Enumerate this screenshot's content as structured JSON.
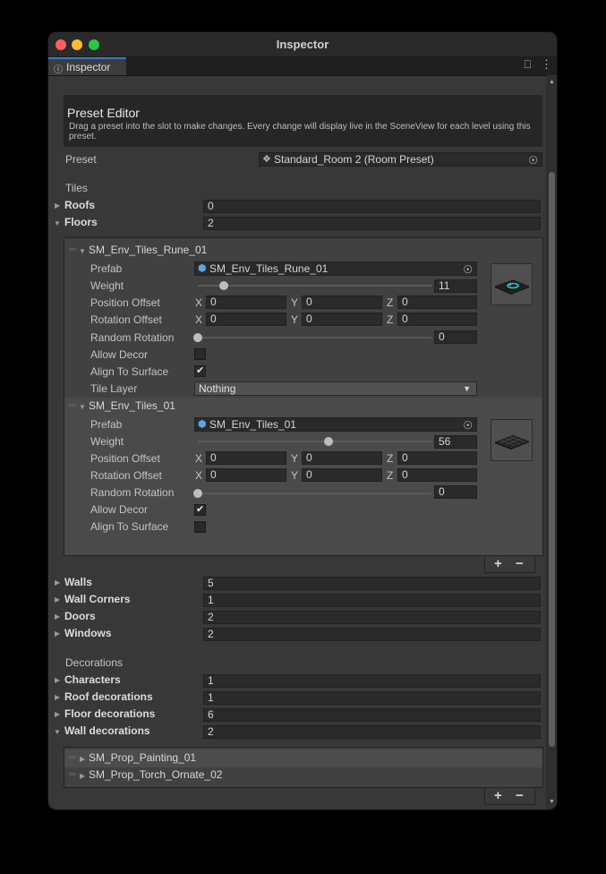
{
  "window": {
    "title": "Inspector"
  },
  "tab": {
    "label": "Inspector"
  },
  "header": {
    "title": "Preset Editor",
    "description": "Drag a preset into the slot to make changes. Every change will display live in the SceneView for each level using this preset."
  },
  "preset": {
    "label": "Preset",
    "value": "Standard_Room 2 (Room Preset)"
  },
  "tiles": {
    "section": "Tiles",
    "roofs": {
      "label": "Roofs",
      "value": "0"
    },
    "floors": {
      "label": "Floors",
      "value": "2"
    }
  },
  "floor_items": [
    {
      "name": "SM_Env_Tiles_Rune_01",
      "prefab_label": "Prefab",
      "prefab": "SM_Env_Tiles_Rune_01",
      "weight_label": "Weight",
      "weight": "11",
      "weight_fraction": 0.11,
      "position_label": "Position Offset",
      "pos_x": "0",
      "pos_y": "0",
      "pos_z": "0",
      "rotation_label": "Rotation Offset",
      "rot_x": "0",
      "rot_y": "0",
      "rot_z": "0",
      "random_rotation_label": "Random Rotation",
      "random_rotation": "0",
      "random_rotation_fraction": 0,
      "allow_decor_label": "Allow Decor",
      "allow_decor": false,
      "align_label": "Align To Surface",
      "align": true,
      "tile_layer_label": "Tile Layer",
      "tile_layer": "Nothing"
    },
    {
      "name": "SM_Env_Tiles_01",
      "prefab_label": "Prefab",
      "prefab": "SM_Env_Tiles_01",
      "weight_label": "Weight",
      "weight": "56",
      "weight_fraction": 0.56,
      "position_label": "Position Offset",
      "pos_x": "0",
      "pos_y": "0",
      "pos_z": "0",
      "rotation_label": "Rotation Offset",
      "rot_x": "0",
      "rot_y": "0",
      "rot_z": "0",
      "random_rotation_label": "Random Rotation",
      "random_rotation": "0",
      "random_rotation_fraction": 0,
      "allow_decor_label": "Allow Decor",
      "allow_decor": true,
      "align_label": "Align To Surface",
      "align": false
    }
  ],
  "axis": {
    "x": "X",
    "y": "Y",
    "z": "Z"
  },
  "list_buttons": {
    "add": "+",
    "remove": "−"
  },
  "structure": [
    {
      "label": "Walls",
      "value": "5"
    },
    {
      "label": "Wall Corners",
      "value": "1"
    },
    {
      "label": "Doors",
      "value": "2"
    },
    {
      "label": "Windows",
      "value": "2"
    }
  ],
  "decorations": {
    "section": "Decorations",
    "items": [
      {
        "label": "Characters",
        "value": "1"
      },
      {
        "label": "Roof decorations",
        "value": "1"
      },
      {
        "label": "Floor decorations",
        "value": "6"
      },
      {
        "label": "Wall decorations",
        "value": "2"
      }
    ]
  },
  "wall_decoration_items": [
    "SM_Prop_Painting_01",
    "SM_Prop_Torch_Ornate_02"
  ],
  "colors": {
    "tab_accent": "#3a78c8",
    "close": "#ff5f57",
    "minimize": "#febc2e",
    "zoom": "#28c840"
  }
}
